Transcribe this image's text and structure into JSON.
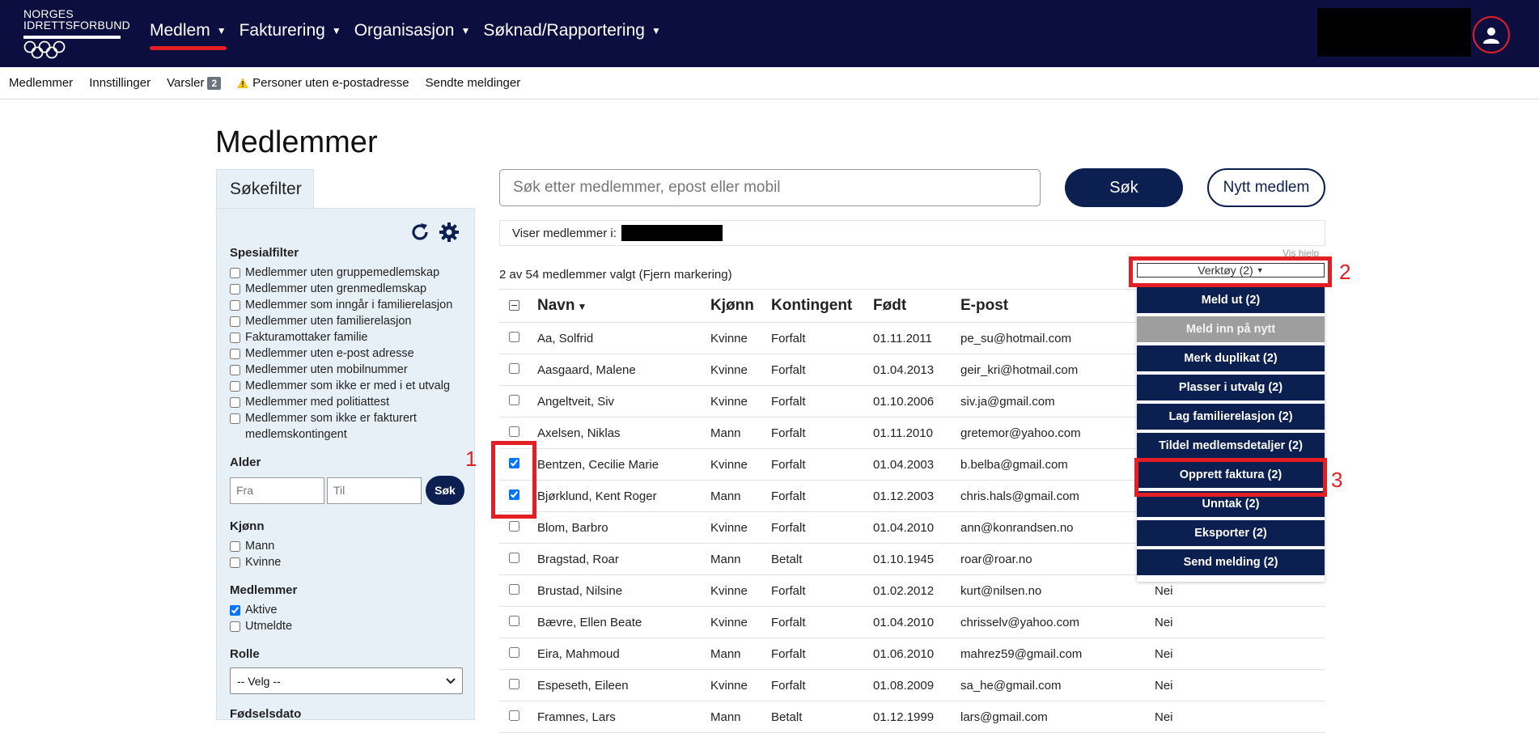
{
  "brand": {
    "line1": "NORGES",
    "line2": "IDRETTSFORBUND"
  },
  "topnav": {
    "items": [
      {
        "label": "Medlem",
        "active": true
      },
      {
        "label": "Fakturering"
      },
      {
        "label": "Organisasjon"
      },
      {
        "label": "Søknad/Rapportering"
      }
    ]
  },
  "subnav": {
    "members": "Medlemmer",
    "settings": "Innstillinger",
    "alerts": "Varsler",
    "alerts_count": "2",
    "no_email": "Personer uten e-postadresse",
    "sent": "Sendte meldinger"
  },
  "page": {
    "title": "Medlemmer"
  },
  "filter": {
    "tab": "Søkefilter",
    "special_title": "Spesialfilter",
    "special": [
      "Medlemmer uten gruppemedlemskap",
      "Medlemmer uten grenmedlemskap",
      "Medlemmer som inngår i familierelasjon",
      "Medlemmer uten familierelasjon",
      "Fakturamottaker familie",
      "Medlemmer uten e-post adresse",
      "Medlemmer uten mobilnummer",
      "Medlemmer som ikke er med i et utvalg",
      "Medlemmer med politiattest",
      "Medlemmer som ikke er fakturert medlemskontingent"
    ],
    "age_title": "Alder",
    "age_from_placeholder": "Fra",
    "age_to_placeholder": "Til",
    "age_search": "Søk",
    "gender_title": "Kjønn",
    "gender_male": "Mann",
    "gender_female": "Kvinne",
    "members_title": "Medlemmer",
    "members_active": "Aktive",
    "members_resigned": "Utmeldte",
    "role_title": "Rolle",
    "role_selected": "-- Velg --",
    "birthdate_title": "Fødselsdato"
  },
  "search": {
    "placeholder": "Søk etter medlemmer, epost eller mobil",
    "button": "Søk",
    "new_member": "Nytt medlem"
  },
  "showing": {
    "label": "Viser medlemmer i:"
  },
  "help_link": "Vis hjelp",
  "selection": {
    "text": "2 av 54 medlemmer valgt",
    "clear": "(Fjern markering)"
  },
  "table": {
    "headers": {
      "name": "Navn",
      "gender": "Kjønn",
      "fee": "Kontingent",
      "born": "Født",
      "email": "E-post"
    },
    "rows": [
      {
        "name": "Aa, Solfrid",
        "gender": "Kvinne",
        "fee": "Forfalt",
        "born": "01.11.2011",
        "email": "pe_su@hotmail.com",
        "extra": "",
        "checked": false
      },
      {
        "name": "Aasgaard, Malene",
        "gender": "Kvinne",
        "fee": "Forfalt",
        "born": "01.04.2013",
        "email": "geir_kri@hotmail.com",
        "extra": "",
        "checked": false
      },
      {
        "name": "Angeltveit, Siv",
        "gender": "Kvinne",
        "fee": "Forfalt",
        "born": "01.10.2006",
        "email": "siv.ja@gmail.com",
        "extra": "",
        "checked": false
      },
      {
        "name": "Axelsen, Niklas",
        "gender": "Mann",
        "fee": "Forfalt",
        "born": "01.11.2010",
        "email": "gretemor@yahoo.com",
        "extra": "",
        "checked": false
      },
      {
        "name": "Bentzen, Cecilie Marie",
        "gender": "Kvinne",
        "fee": "Forfalt",
        "born": "01.04.2003",
        "email": "b.belba@gmail.com",
        "extra": "",
        "checked": true
      },
      {
        "name": "Bjørklund, Kent Roger",
        "gender": "Mann",
        "fee": "Forfalt",
        "born": "01.12.2003",
        "email": "chris.hals@gmail.com",
        "extra": "",
        "checked": true
      },
      {
        "name": "Blom, Barbro",
        "gender": "Kvinne",
        "fee": "Forfalt",
        "born": "01.04.2010",
        "email": "ann@konrandsen.no",
        "extra": "",
        "checked": false
      },
      {
        "name": "Bragstad, Roar",
        "gender": "Mann",
        "fee": "Betalt",
        "born": "01.10.1945",
        "email": "roar@roar.no",
        "extra": "",
        "checked": false
      },
      {
        "name": "Brustad, Nilsine",
        "gender": "Kvinne",
        "fee": "Forfalt",
        "born": "01.02.2012",
        "email": "kurt@nilsen.no",
        "extra": "Nei",
        "checked": false
      },
      {
        "name": "Bævre, Ellen Beate",
        "gender": "Kvinne",
        "fee": "Forfalt",
        "born": "01.04.2010",
        "email": "chrisselv@yahoo.com",
        "extra": "Nei",
        "checked": false
      },
      {
        "name": "Eira, Mahmoud",
        "gender": "Mann",
        "fee": "Forfalt",
        "born": "01.06.2010",
        "email": "mahrez59@gmail.com",
        "extra": "Nei",
        "checked": false
      },
      {
        "name": "Espeseth, Eileen",
        "gender": "Kvinne",
        "fee": "Forfalt",
        "born": "01.08.2009",
        "email": "sa_he@gmail.com",
        "extra": "Nei",
        "checked": false
      },
      {
        "name": "Framnes, Lars",
        "gender": "Mann",
        "fee": "Betalt",
        "born": "01.12.1999",
        "email": "lars@gmail.com",
        "extra": "Nei",
        "checked": false
      }
    ]
  },
  "tools": {
    "toggle_label": "Verktøy (2)",
    "items": [
      {
        "label": "Meld ut (2)",
        "disabled": false
      },
      {
        "label": "Meld inn på nytt",
        "disabled": true
      },
      {
        "label": "Merk duplikat (2)",
        "disabled": false
      },
      {
        "label": "Plasser i utvalg (2)",
        "disabled": false
      },
      {
        "label": "Lag familierelasjon (2)",
        "disabled": false
      },
      {
        "label": "Tildel medlemsdetaljer (2)",
        "disabled": false
      },
      {
        "label": "Opprett faktura (2)",
        "disabled": false
      },
      {
        "label": "Unntak (2)",
        "disabled": false
      },
      {
        "label": "Eksporter (2)",
        "disabled": false
      },
      {
        "label": "Send melding (2)",
        "disabled": false
      }
    ]
  },
  "annotations": {
    "one": "1",
    "two": "2",
    "three": "3"
  },
  "colors": {
    "nav_bg": "#0b0e3f",
    "primary": "#0b1f50",
    "accent_red": "#e31e24",
    "panel_bg": "#e8f0f7"
  }
}
